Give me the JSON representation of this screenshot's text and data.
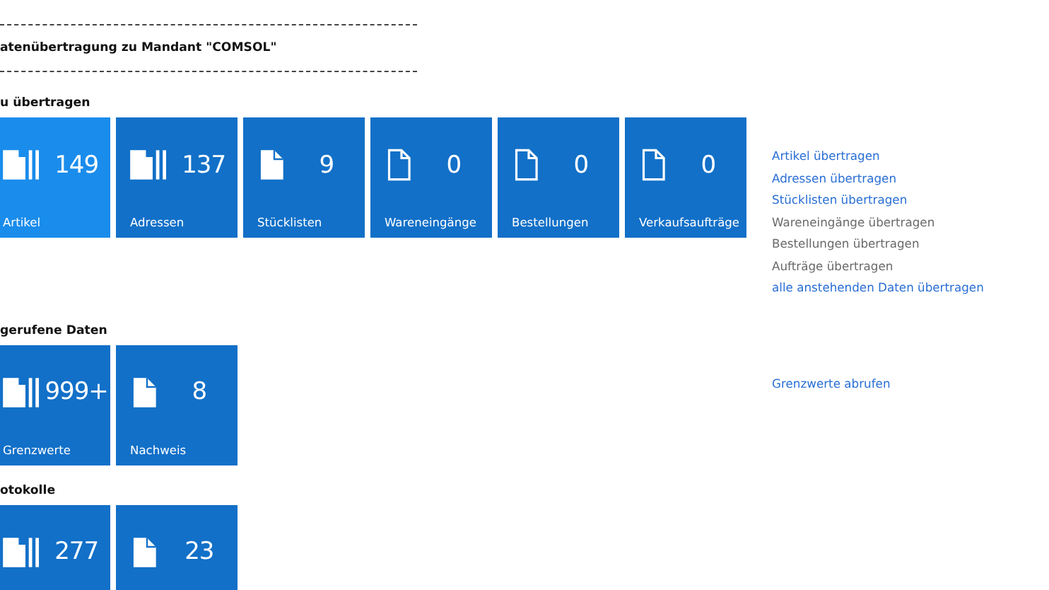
{
  "header": {
    "title": "atenübertragung zu Mandant \"COMSOL\""
  },
  "sections": [
    {
      "heading": "u übertragen",
      "tiles": [
        {
          "kind": "stack",
          "count": "149",
          "label": "Artikel",
          "selected": true
        },
        {
          "kind": "stack",
          "count": "137",
          "label": "Adressen",
          "selected": false
        },
        {
          "kind": "filled",
          "count": "9",
          "label": "Stücklisten",
          "selected": false
        },
        {
          "kind": "outline",
          "count": "0",
          "label": "Wareneingänge",
          "selected": false
        },
        {
          "kind": "outline",
          "count": "0",
          "label": "Bestellungen",
          "selected": false
        },
        {
          "kind": "outline",
          "count": "0",
          "label": "Verkaufsaufträge",
          "selected": false
        }
      ],
      "links": [
        {
          "text": "Artikel übertragen",
          "disabled": false
        },
        {
          "text": "Adressen übertragen",
          "disabled": false
        },
        {
          "text": "Stücklisten übertragen",
          "disabled": false
        },
        {
          "text": "Wareneingänge übertragen",
          "disabled": true
        },
        {
          "text": "Bestellungen übertragen",
          "disabled": true
        },
        {
          "text": "Aufträge übertragen",
          "disabled": true
        },
        {
          "text": "alle anstehenden Daten übertragen",
          "disabled": false
        }
      ]
    },
    {
      "heading": "gerufene Daten",
      "tiles": [
        {
          "kind": "stack",
          "count": "999+",
          "label": "Grenzwerte",
          "selected": false
        },
        {
          "kind": "filled",
          "count": "8",
          "label": "Nachweis",
          "selected": false
        }
      ],
      "links": [
        {
          "text": "Grenzwerte abrufen",
          "disabled": false
        }
      ]
    },
    {
      "heading": "otokolle",
      "tiles": [
        {
          "kind": "stack",
          "count": "277",
          "selected": false
        },
        {
          "kind": "filled",
          "count": "23",
          "selected": false
        }
      ]
    }
  ]
}
